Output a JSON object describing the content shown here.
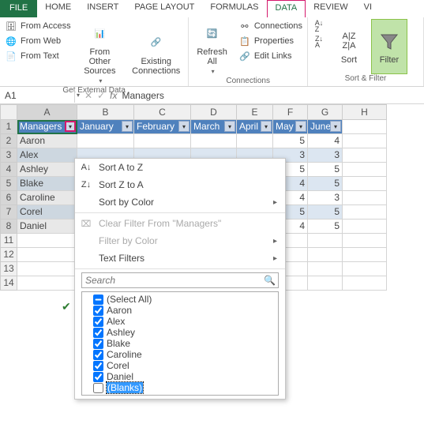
{
  "tabs": [
    "FILE",
    "HOME",
    "INSERT",
    "PAGE LAYOUT",
    "FORMULAS",
    "DATA",
    "REVIEW",
    "VI"
  ],
  "active_tab": "DATA",
  "ribbon": {
    "ext": {
      "items": [
        "From Access",
        "From Web",
        "From Text"
      ],
      "other": "From Other\nSources",
      "existing": "Existing\nConnections",
      "label": "Get External Data"
    },
    "conn": {
      "refresh": "Refresh\nAll",
      "items": [
        "Connections",
        "Properties",
        "Edit Links"
      ],
      "label": "Connections"
    },
    "sort": {
      "sort": "Sort",
      "filter": "Filter",
      "label": "Sort & Filter"
    }
  },
  "namebox": "A1",
  "formula": "Managers",
  "cols": [
    "A",
    "B",
    "C",
    "D",
    "E",
    "F",
    "G",
    "H"
  ],
  "headers": [
    "Managers",
    "January",
    "February",
    "March",
    "April",
    "May",
    "June"
  ],
  "rows": [
    {
      "n": "2",
      "name": "Aaron",
      "may": "5",
      "jun": "4",
      "striped": false
    },
    {
      "n": "3",
      "name": "Alex",
      "may": "3",
      "jun": "3",
      "striped": true
    },
    {
      "n": "4",
      "name": "Ashley",
      "may": "5",
      "jun": "5",
      "striped": false
    },
    {
      "n": "5",
      "name": "Blake",
      "may": "4",
      "jun": "5",
      "striped": true
    },
    {
      "n": "6",
      "name": "Caroline",
      "may": "4",
      "jun": "3",
      "striped": false
    },
    {
      "n": "7",
      "name": "Corel",
      "may": "5",
      "jun": "5",
      "striped": true
    },
    {
      "n": "8",
      "name": "Daniel",
      "may": "4",
      "jun": "5",
      "striped": false
    }
  ],
  "empty_rows": [
    "11",
    "12",
    "13",
    "14"
  ],
  "menu": {
    "sort_az": "Sort A to Z",
    "sort_za": "Sort Z to A",
    "sort_color": "Sort by Color",
    "clear": "Clear Filter From \"Managers\"",
    "filter_color": "Filter by Color",
    "text_filters": "Text Filters",
    "search_ph": "Search",
    "items": [
      "(Select All)",
      "Aaron",
      "Alex",
      "Ashley",
      "Blake",
      "Caroline",
      "Corel",
      "Daniel",
      "(Blanks)"
    ]
  }
}
